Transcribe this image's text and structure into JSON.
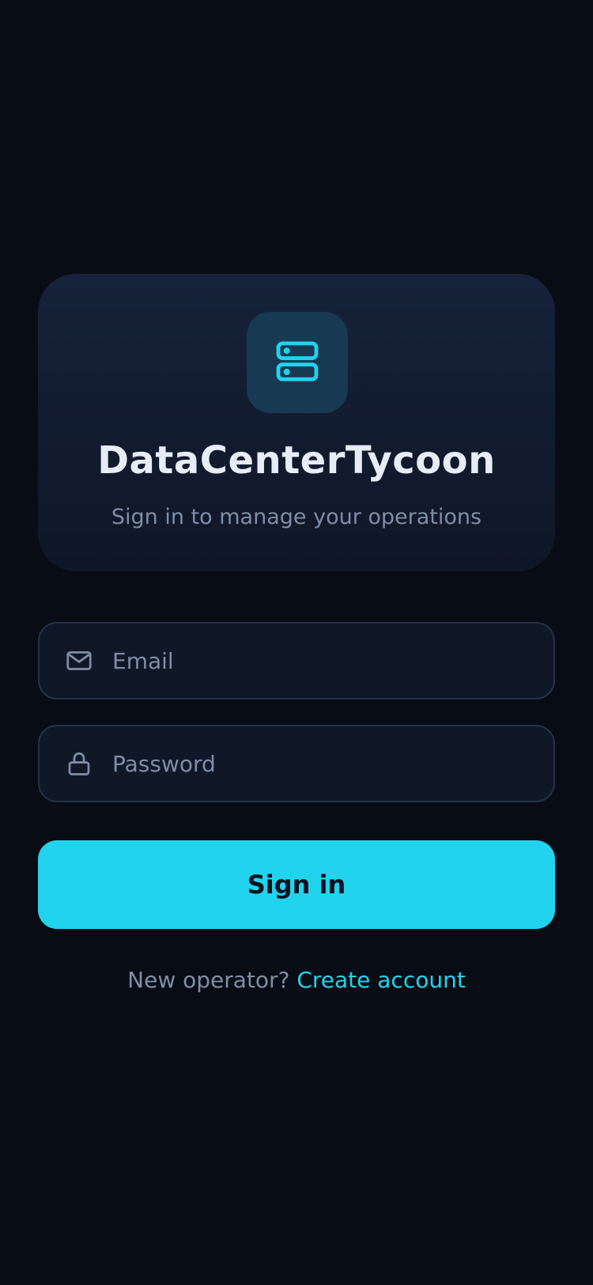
{
  "colors": {
    "background": "#080c14",
    "card": "#16223a",
    "accent": "#22d3ee",
    "text_primary": "#e6edf7",
    "text_muted": "#7f8ea6",
    "field_border": "#253047"
  },
  "header": {
    "logo_icon": "server-icon",
    "title": "DataCenterTycoon",
    "subtitle": "Sign in to manage your operations"
  },
  "form": {
    "email": {
      "icon": "mail-icon",
      "placeholder": "Email",
      "value": ""
    },
    "password": {
      "icon": "lock-icon",
      "placeholder": "Password",
      "value": ""
    },
    "submit_label": "Sign in"
  },
  "footer": {
    "prompt": "New operator?",
    "link_label": "Create account"
  }
}
